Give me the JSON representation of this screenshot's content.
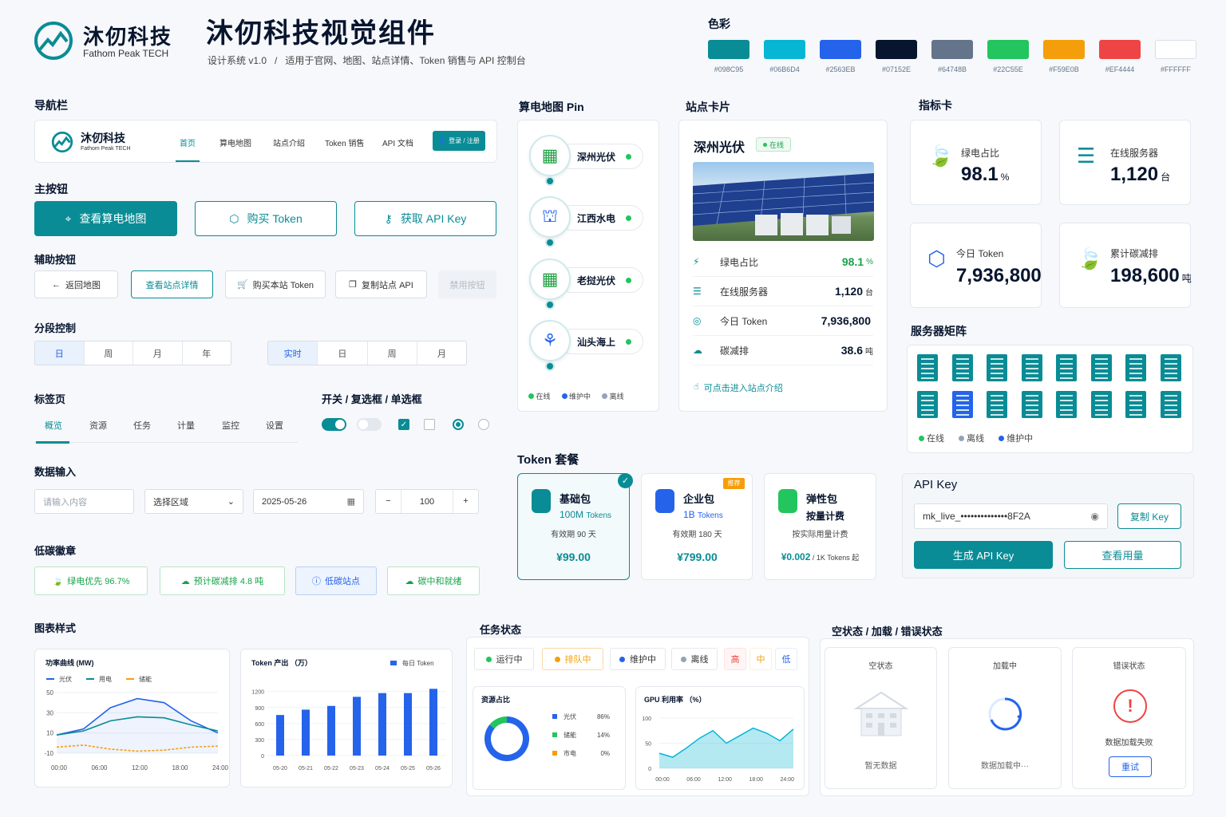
{
  "brand": {
    "name": "沐仞科技",
    "sub": "Fathom Peak TECH"
  },
  "header": {
    "title": "沐仞科技视觉组件",
    "subtitle": "设计系统 v1.0   /   适用于官网、地图、站点详情、Token 销售与 API 控制台"
  },
  "palette": {
    "title": "色彩",
    "colors": [
      "#098C95",
      "#06B6D4",
      "#2563EB",
      "#07152E",
      "#64748B",
      "#22C55E",
      "#F59E0B",
      "#EF4444",
      "#FFFFFF"
    ]
  },
  "nav": {
    "title": "导航栏",
    "brand": "沐仞科技",
    "brand_sub": "Fathom Peak TECH",
    "items": [
      "首页",
      "算电地图",
      "站点介绍",
      "Token 销售",
      "API 文档"
    ],
    "login": "登录 / 注册"
  },
  "primary": {
    "title": "主按钮",
    "buttons": [
      "查看算电地图",
      "购买 Token",
      "获取 API Key"
    ]
  },
  "secondary": {
    "title": "辅助按钮",
    "buttons": [
      "返回地图",
      "查看站点详情",
      "购买本站 Token",
      "复制站点 API",
      "禁用按钮"
    ]
  },
  "segment": {
    "title": "分段控制",
    "a": [
      "日",
      "周",
      "月",
      "年"
    ],
    "b": [
      "实时",
      "日",
      "周",
      "月"
    ]
  },
  "tabs": {
    "title": "标签页",
    "items": [
      "概览",
      "资源",
      "任务",
      "计量",
      "监控",
      "设置"
    ]
  },
  "toggles": {
    "title": "开关 / 复选框 / 单选框"
  },
  "input": {
    "title": "数据输入",
    "placeholder": "请输入内容",
    "select": "选择区域",
    "date": "2025-05-26",
    "stepper": "100",
    "minus": "−",
    "plus": "+"
  },
  "badges": {
    "title": "低碳徽章",
    "items": [
      "绿电优先 96.7%",
      "预计碳减排 4.8 吨",
      "低碳站点",
      "碳中和就绪"
    ]
  },
  "map": {
    "title": "算电地图 Pin",
    "pins": [
      "深州光伏",
      "江西水电",
      "老挝光伏",
      "汕头海上"
    ],
    "legend": [
      "在线",
      "维护中",
      "离线"
    ]
  },
  "station": {
    "title": "站点卡片",
    "name": "深州光伏",
    "status": "在线",
    "rows": [
      {
        "label": "绿电占比",
        "value": "98.1",
        "unit": "%"
      },
      {
        "label": "在线服务器",
        "value": "1,120",
        "unit": "台"
      },
      {
        "label": "今日 Token",
        "value": "7,936,800",
        "unit": ""
      },
      {
        "label": "碳减排",
        "value": "38.6",
        "unit": "吨"
      }
    ],
    "link": "可点击进入站点介绍"
  },
  "metrics": {
    "title": "指标卡",
    "items": [
      {
        "label": "绿电占比",
        "value": "98.1",
        "unit": "%"
      },
      {
        "label": "在线服务器",
        "value": "1,120",
        "unit": "台"
      },
      {
        "label": "今日 Token",
        "value": "7,936,800",
        "unit": ""
      },
      {
        "label": "累计碳减排",
        "value": "198,600",
        "unit": "吨"
      }
    ]
  },
  "matrix": {
    "title": "服务器矩阵",
    "legend": [
      "在线",
      "离线",
      "维护中"
    ]
  },
  "token": {
    "title": "Token 套餐",
    "plans": [
      {
        "name": "基础包",
        "amount": "100M",
        "unit": "Tokens",
        "term": "有效期 90 天",
        "price": "¥99.00",
        "tag": ""
      },
      {
        "name": "企业包",
        "amount": "1B",
        "unit": "Tokens",
        "term": "有效期 180 天",
        "price": "¥799.00",
        "tag": "推荐"
      },
      {
        "name": "弹性包",
        "amount": "按量计费",
        "unit": "",
        "term": "按实际用量计费",
        "price": "¥0.002",
        "price_sub": " / 1K Tokens 起",
        "tag": ""
      }
    ]
  },
  "api": {
    "title": "API Key",
    "key": "mk_live_••••••••••••••8F2A",
    "copy": "复制 Key",
    "gen": "生成 API Key",
    "usage": "查看用量"
  },
  "charts": {
    "title": "图表样式"
  },
  "tasks": {
    "title": "任务状态",
    "items": [
      "运行中",
      "排队中",
      "维护中",
      "离线"
    ],
    "levels": [
      "高",
      "中",
      "低"
    ]
  },
  "states": {
    "title": "空状态 / 加载 / 错误状态",
    "empty": {
      "title": "空状态",
      "text": "暂无数据"
    },
    "loading": {
      "title": "加载中",
      "text": "数据加载中···"
    },
    "error": {
      "title": "错误状态",
      "text": "数据加载失败",
      "btn": "重试"
    }
  },
  "chart_data": [
    {
      "type": "line",
      "title": "功率曲线 (MW)",
      "x": [
        "00:00",
        "06:00",
        "12:00",
        "18:00",
        "24:00"
      ],
      "yticks": [
        50,
        30,
        10,
        -10
      ],
      "ylim": [
        -10,
        50
      ],
      "series": [
        {
          "name": "光伏",
          "color": "#2563EB",
          "values": [
            8,
            14,
            35,
            44,
            40,
            22,
            10
          ]
        },
        {
          "name": "用电",
          "color": "#098C95",
          "values": [
            8,
            12,
            22,
            26,
            25,
            18,
            12
          ]
        },
        {
          "name": "储能",
          "color": "#F59E0B",
          "values": [
            -4,
            -2,
            -6,
            -8,
            -7,
            -4,
            -3
          ]
        }
      ]
    },
    {
      "type": "bar",
      "title": "Token 产出 （万）",
      "legend": "每日 Token",
      "categories": [
        "05-20",
        "05-21",
        "05-22",
        "05-23",
        "05-24",
        "05-25",
        "05-26"
      ],
      "values": [
        760,
        860,
        930,
        1100,
        1170,
        1170,
        1250
      ],
      "yticks": [
        1200,
        900,
        600,
        300,
        0
      ],
      "ylim": [
        0,
        1300
      ]
    },
    {
      "type": "pie",
      "title": "资源占比",
      "series": [
        {
          "name": "光伏",
          "value": 86,
          "label": "86%",
          "color": "#2563EB"
        },
        {
          "name": "储能",
          "value": 14,
          "label": "14%",
          "color": "#22C55E"
        },
        {
          "name": "市电",
          "value": 0,
          "label": "0%",
          "color": "#F59E0B"
        }
      ]
    },
    {
      "type": "area",
      "title": "GPU 利用率 （%）",
      "x": [
        "00:00",
        "06:00",
        "12:00",
        "18:00",
        "24:00"
      ],
      "yticks": [
        100,
        50,
        0
      ],
      "ylim": [
        0,
        100
      ],
      "values": [
        30,
        22,
        40,
        60,
        75,
        50,
        65,
        80,
        70,
        55,
        78
      ]
    }
  ]
}
